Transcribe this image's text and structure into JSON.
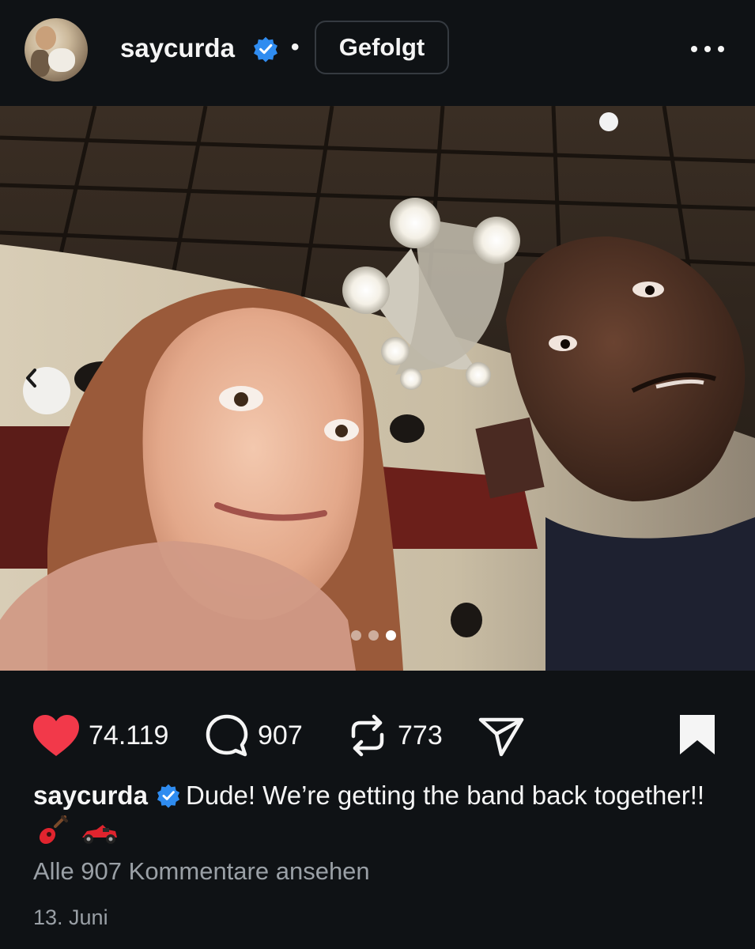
{
  "post": {
    "username": "saycurda",
    "separator": "•",
    "follow_label": "Gefolgt",
    "carousel": {
      "slide_count": 3,
      "active_index": 2
    }
  },
  "stats": {
    "likes": "74.119",
    "comments": "907",
    "reposts": "773"
  },
  "caption": {
    "username": "saycurda",
    "text": "Dude! We’re getting the band back together!!",
    "emojis": [
      "guitar-emoji",
      "race-car-emoji"
    ]
  },
  "view_comments": "Alle 907 Kommentare ansehen",
  "date": "13. Juni",
  "colors": {
    "background": "#0f1215",
    "like_red": "#f2394a",
    "verified_blue": "#2f8cf0",
    "secondary_text": "#9aa0a6"
  }
}
